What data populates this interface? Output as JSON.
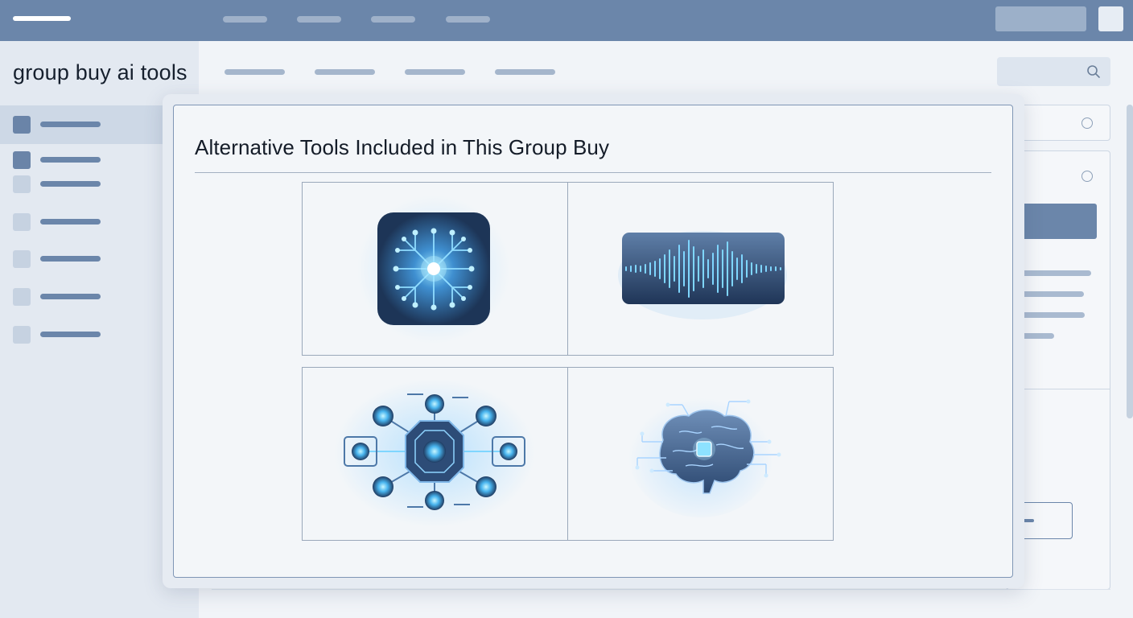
{
  "app": {
    "brand": "group buy ai tools"
  },
  "modal": {
    "title": "Alternative Tools Included in This Group Buy",
    "tools": [
      {
        "icon": "circuit-chip-icon"
      },
      {
        "icon": "audio-waveform-icon"
      },
      {
        "icon": "network-hub-icon"
      },
      {
        "icon": "ai-brain-icon"
      }
    ]
  },
  "colors": {
    "accent": "#6b86aa",
    "glow": "#5fd0ff",
    "icon_dark": "#1e3658"
  }
}
